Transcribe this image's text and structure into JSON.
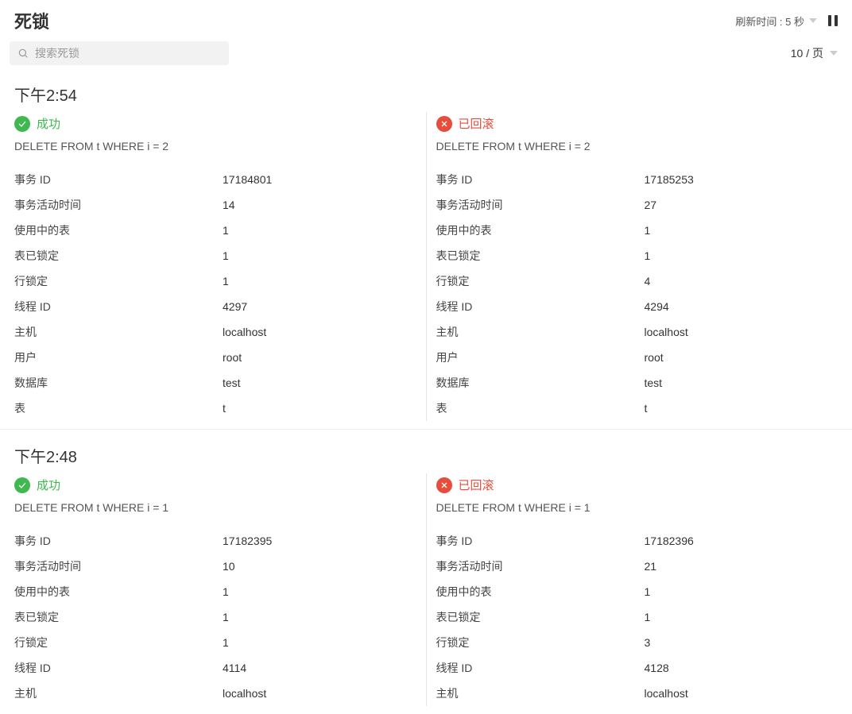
{
  "header": {
    "title": "死锁",
    "refresh_label": "刷新时间 : 5 秒"
  },
  "search": {
    "placeholder": "搜索死锁"
  },
  "pager": {
    "label": "10 / 页"
  },
  "status": {
    "success_label": "成功",
    "rolled_label": "已回滚"
  },
  "labels": {
    "txn_id": "事务 ID",
    "txn_active_time": "事务活动时间",
    "tables_in_use": "使用中的表",
    "tables_locked": "表已锁定",
    "rows_locked": "行锁定",
    "thread_id": "线程 ID",
    "host": "主机",
    "user": "用户",
    "database": "数据库",
    "table": "表"
  },
  "groups": [
    {
      "time": "下午2:54",
      "left": {
        "status": "success",
        "sql": "DELETE FROM t WHERE i = 2",
        "txn_id": "17184801",
        "txn_active_time": "14",
        "tables_in_use": "1",
        "tables_locked": "1",
        "rows_locked": "1",
        "thread_id": "4297",
        "host": "localhost",
        "user": "root",
        "database": "test",
        "table": "t"
      },
      "right": {
        "status": "rolled",
        "sql": "DELETE FROM t WHERE i = 2",
        "txn_id": "17185253",
        "txn_active_time": "27",
        "tables_in_use": "1",
        "tables_locked": "1",
        "rows_locked": "4",
        "thread_id": "4294",
        "host": "localhost",
        "user": "root",
        "database": "test",
        "table": "t"
      }
    },
    {
      "time": "下午2:48",
      "left": {
        "status": "success",
        "sql": "DELETE FROM t WHERE i = 1",
        "txn_id": "17182395",
        "txn_active_time": "10",
        "tables_in_use": "1",
        "tables_locked": "1",
        "rows_locked": "1",
        "thread_id": "4114",
        "host": "localhost"
      },
      "right": {
        "status": "rolled",
        "sql": "DELETE FROM t WHERE i = 1",
        "txn_id": "17182396",
        "txn_active_time": "21",
        "tables_in_use": "1",
        "tables_locked": "1",
        "rows_locked": "3",
        "thread_id": "4128",
        "host": "localhost"
      }
    }
  ]
}
